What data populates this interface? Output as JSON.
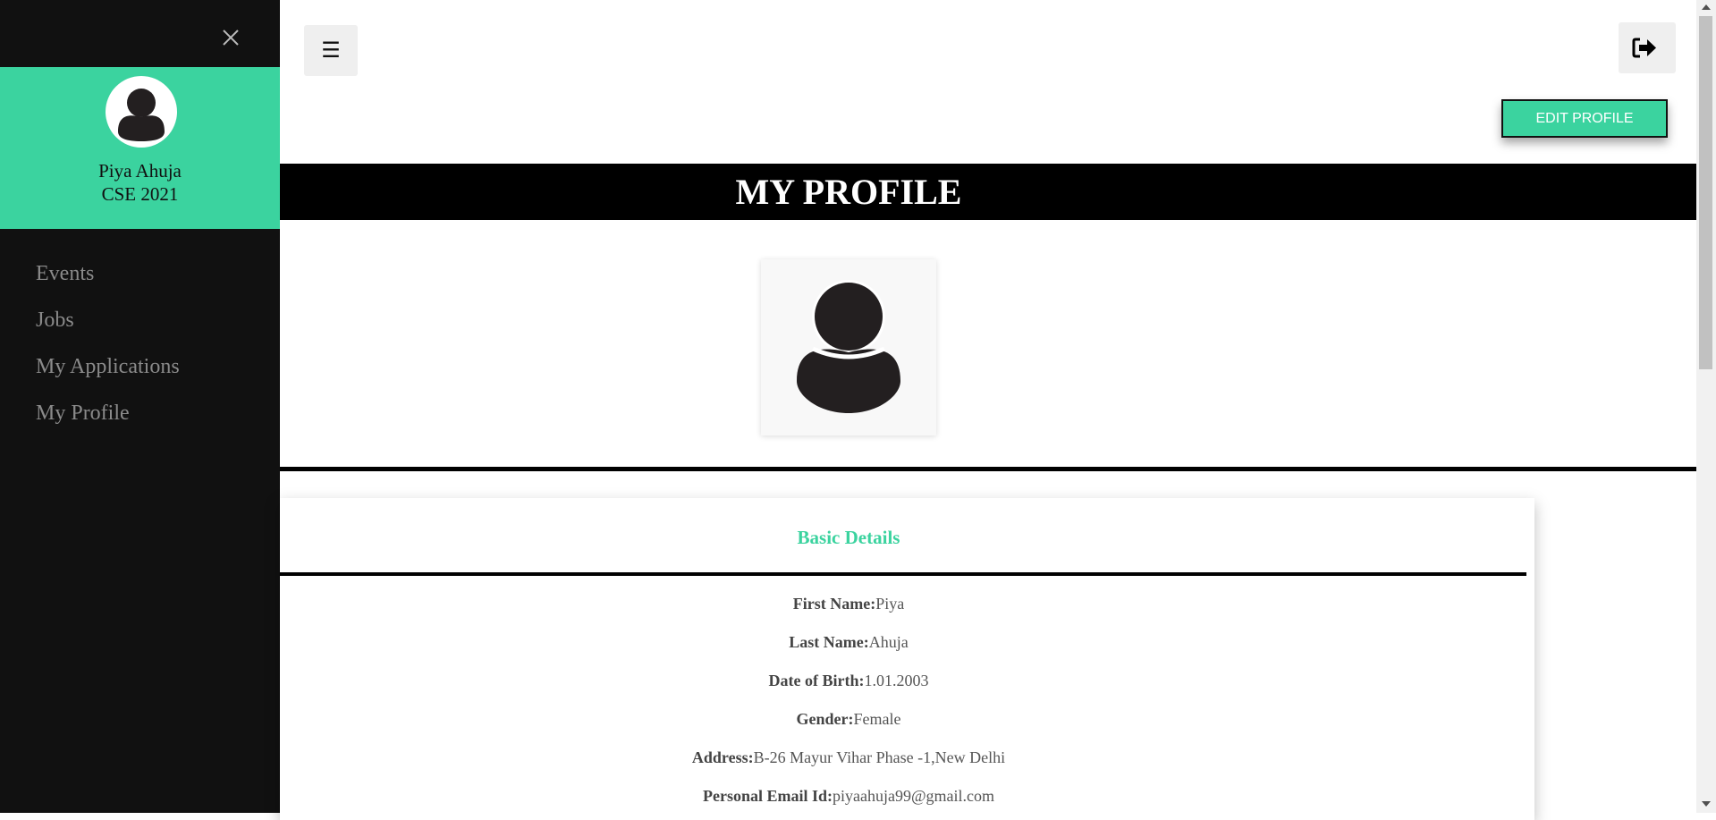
{
  "sidebar": {
    "user_name": "Piya Ahuja",
    "user_batch": "CSE 2021",
    "nav_items": [
      {
        "label": "Events"
      },
      {
        "label": "Jobs"
      },
      {
        "label": "My Applications"
      },
      {
        "label": "My Profile"
      }
    ]
  },
  "header": {
    "menu_icon": "☰",
    "edit_profile_label": "EDIT PROFILE"
  },
  "page": {
    "title": "MY PROFILE"
  },
  "basic_details": {
    "heading": "Basic Details",
    "fields": [
      {
        "label": "First Name:",
        "value": "Piya"
      },
      {
        "label": "Last Name:",
        "value": "Ahuja"
      },
      {
        "label": "Date of Birth:",
        "value": "1.01.2003"
      },
      {
        "label": "Gender:",
        "value": "Female"
      },
      {
        "label": "Address:",
        "value": "B-26 Mayur Vihar Phase -1,New Delhi"
      },
      {
        "label": "Personal Email Id:",
        "value": "piyaahuja99@gmail.com"
      }
    ]
  },
  "colors": {
    "accent": "#3bd39f",
    "sidebar_bg": "#111111",
    "title_bar_bg": "#000000"
  }
}
